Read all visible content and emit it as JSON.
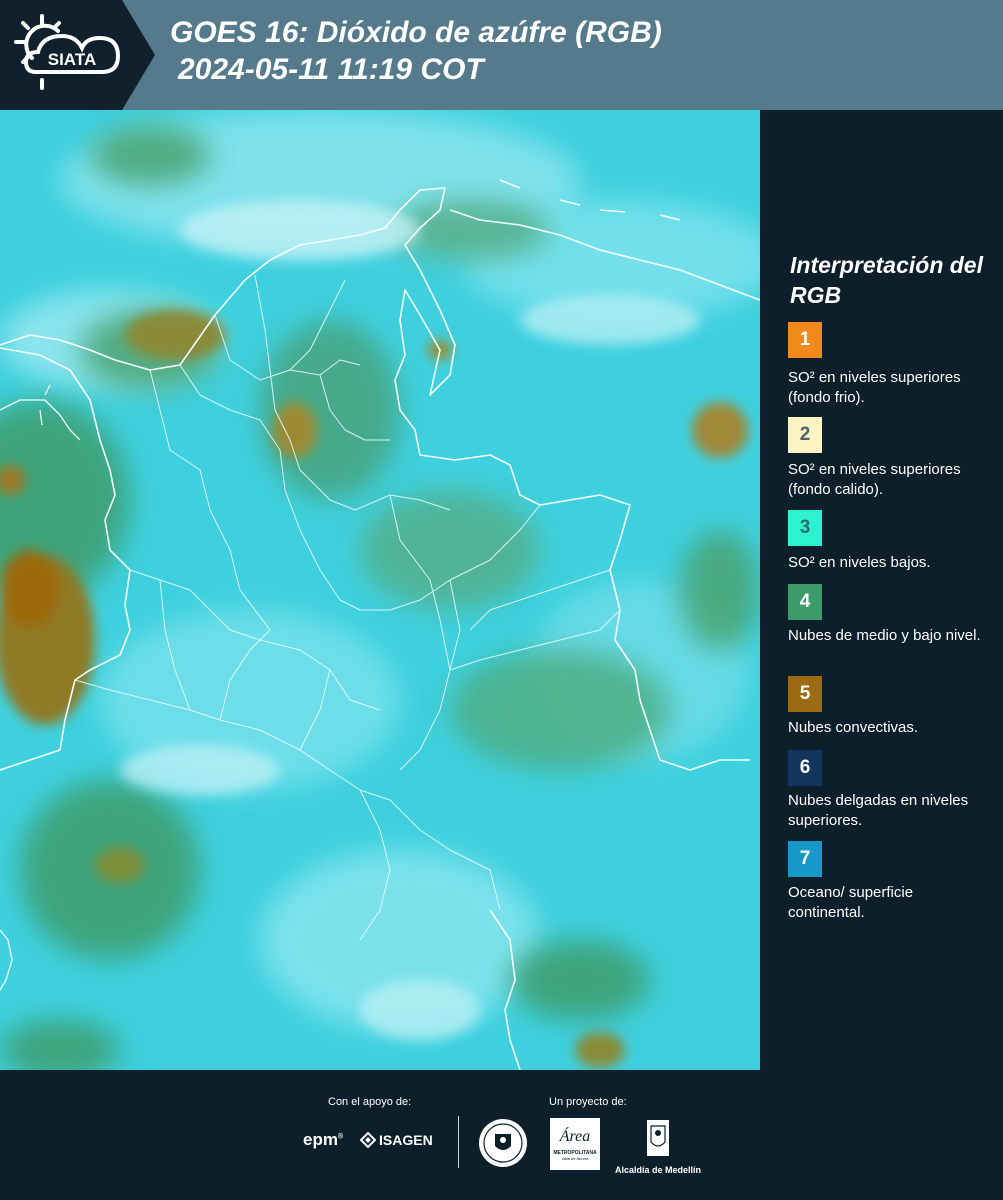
{
  "header": {
    "logo_text": "SIATA",
    "title_line1": "GOES 16: Dióxido de azúfre (RGB)",
    "title_line2": "2024-05-11 11:19 COT"
  },
  "legend": {
    "title": "Interpretación del RGB",
    "items": [
      {
        "num": "1",
        "color": "#f28a1a",
        "num_color": "#ffffff",
        "desc": "SO² en niveles superiores (fondo frio)."
      },
      {
        "num": "2",
        "color": "#fbf3c4",
        "num_color": "#53606a",
        "desc": "SO² en niveles superiores (fondo calido)."
      },
      {
        "num": "3",
        "color": "#2cf2cf",
        "num_color": "#2f6a6a",
        "desc": "SO² en niveles bajos."
      },
      {
        "num": "4",
        "color": "#3e9c6b",
        "num_color": "#ffffff",
        "desc": "Nubes de medio y bajo nivel."
      },
      {
        "num": "5",
        "color": "#9c6a10",
        "num_color": "#ffffff",
        "desc": "Nubes convectivas."
      },
      {
        "num": "6",
        "color": "#123560",
        "num_color": "#ffffff",
        "desc": "Nubes delgadas en niveles superiores."
      },
      {
        "num": "7",
        "color": "#1898c8",
        "num_color": "#ffffff",
        "desc": "Oceano/ superficie continental."
      }
    ]
  },
  "footer": {
    "support_label": "Con el apoyo de:",
    "project_label": "Un proyecto de:",
    "epm": "epm",
    "isagen": "ISAGEN",
    "area_text": "Área",
    "area_sub": "METROPOLITANA",
    "area_sub2": "Valle de Aburrá",
    "alcaldia": "Alcaldía de Medellín"
  }
}
